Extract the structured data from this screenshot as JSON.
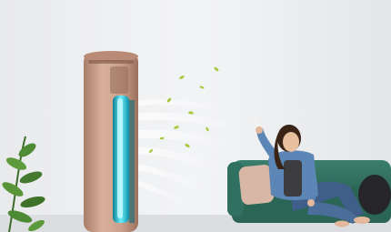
{
  "scene": {
    "description_items": [],
    "colors": {
      "wall": "#eef0f2",
      "floor": "#d8dadd",
      "unit_body": "#c9a08a",
      "unit_light": "#2fd3e6",
      "sofa": "#2f6f5f",
      "denim": "#5a86b4",
      "leaf": "#9bc23a"
    }
  }
}
